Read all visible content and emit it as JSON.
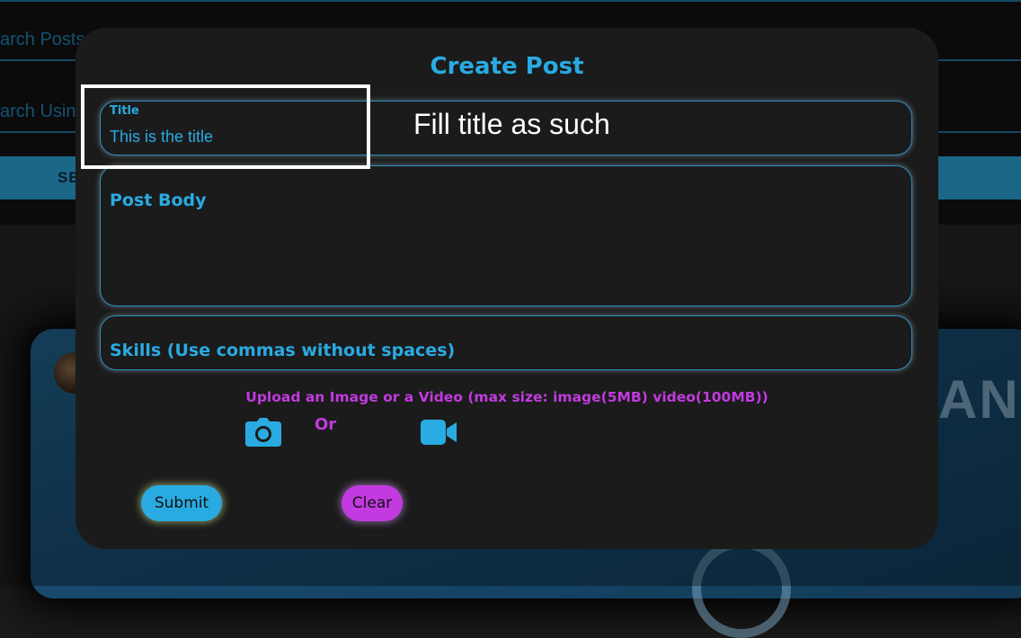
{
  "background": {
    "search_posts_placeholder": "arch Posts",
    "search_using_placeholder": "arch Using",
    "search_button_label": "SE",
    "card_partial_text": "AN"
  },
  "modal": {
    "title": "Create Post",
    "title_field": {
      "label": "Title",
      "value": "This is the title"
    },
    "body_field": {
      "placeholder": "Post Body"
    },
    "skills_field": {
      "placeholder": "Skills (Use commas without spaces)"
    },
    "upload_text": "Upload an Image or a Video (max size: image(5MB) video(100MB))",
    "or_text": "Or",
    "submit_label": "Submit",
    "clear_label": "Clear"
  },
  "annotation": {
    "text": "Fill title as such"
  },
  "colors": {
    "accent_blue": "#29abe2",
    "accent_purple": "#c23ae0",
    "modal_bg": "#1b1b1b"
  },
  "icons": {
    "image_upload": "camera-icon",
    "video_upload": "video-camera-icon"
  }
}
